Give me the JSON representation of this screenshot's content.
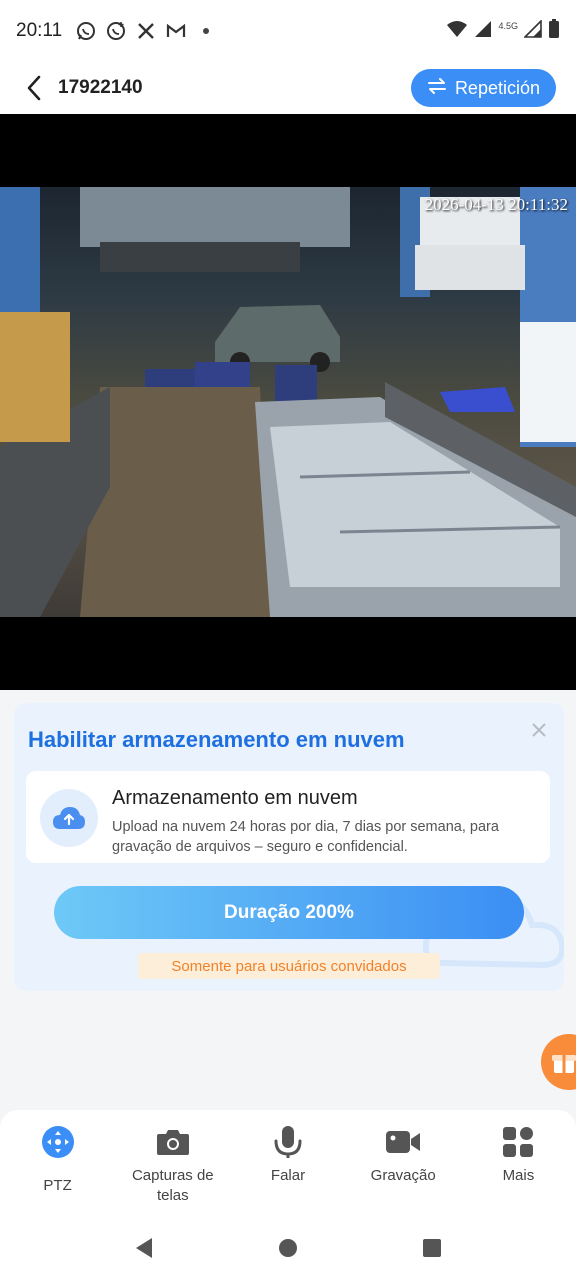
{
  "status_bar": {
    "time": "20:11",
    "network_label": "4.5G"
  },
  "header": {
    "title": "17922140",
    "replay_label": "Repetición"
  },
  "camera": {
    "timestamp": "2026-04-13 20:11:32"
  },
  "cloud_card": {
    "title": "Habilitar armazenamento em nuvem",
    "item_title": "Armazenamento em nuvem",
    "item_desc": "Upload na nuvem 24 horas por dia, 7 dias por semana, para gravação de arquivos – seguro e confidencial.",
    "button_label": "Duração 200%",
    "guest_note": "Somente para usuários convidados"
  },
  "toolbar": {
    "items": [
      {
        "label": "PTZ",
        "icon": "ptz-icon"
      },
      {
        "label": "Capturas de telas",
        "icon": "camera-icon"
      },
      {
        "label": "Falar",
        "icon": "microphone-icon"
      },
      {
        "label": "Gravação",
        "icon": "video-record-icon"
      },
      {
        "label": "Mais",
        "icon": "more-grid-icon"
      }
    ]
  },
  "colors": {
    "accent": "#3a8ef6",
    "title_blue": "#1e6fe0",
    "guest_orange": "#f0822a"
  }
}
